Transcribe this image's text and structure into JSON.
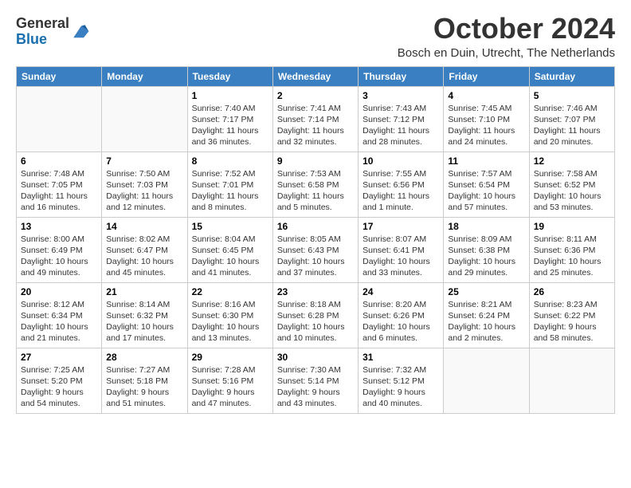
{
  "header": {
    "logo_line1": "General",
    "logo_line2": "Blue",
    "month": "October 2024",
    "location": "Bosch en Duin, Utrecht, The Netherlands"
  },
  "weekdays": [
    "Sunday",
    "Monday",
    "Tuesday",
    "Wednesday",
    "Thursday",
    "Friday",
    "Saturday"
  ],
  "weeks": [
    [
      {
        "day": "",
        "info": ""
      },
      {
        "day": "",
        "info": ""
      },
      {
        "day": "1",
        "info": "Sunrise: 7:40 AM\nSunset: 7:17 PM\nDaylight: 11 hours\nand 36 minutes."
      },
      {
        "day": "2",
        "info": "Sunrise: 7:41 AM\nSunset: 7:14 PM\nDaylight: 11 hours\nand 32 minutes."
      },
      {
        "day": "3",
        "info": "Sunrise: 7:43 AM\nSunset: 7:12 PM\nDaylight: 11 hours\nand 28 minutes."
      },
      {
        "day": "4",
        "info": "Sunrise: 7:45 AM\nSunset: 7:10 PM\nDaylight: 11 hours\nand 24 minutes."
      },
      {
        "day": "5",
        "info": "Sunrise: 7:46 AM\nSunset: 7:07 PM\nDaylight: 11 hours\nand 20 minutes."
      }
    ],
    [
      {
        "day": "6",
        "info": "Sunrise: 7:48 AM\nSunset: 7:05 PM\nDaylight: 11 hours\nand 16 minutes."
      },
      {
        "day": "7",
        "info": "Sunrise: 7:50 AM\nSunset: 7:03 PM\nDaylight: 11 hours\nand 12 minutes."
      },
      {
        "day": "8",
        "info": "Sunrise: 7:52 AM\nSunset: 7:01 PM\nDaylight: 11 hours\nand 8 minutes."
      },
      {
        "day": "9",
        "info": "Sunrise: 7:53 AM\nSunset: 6:58 PM\nDaylight: 11 hours\nand 5 minutes."
      },
      {
        "day": "10",
        "info": "Sunrise: 7:55 AM\nSunset: 6:56 PM\nDaylight: 11 hours\nand 1 minute."
      },
      {
        "day": "11",
        "info": "Sunrise: 7:57 AM\nSunset: 6:54 PM\nDaylight: 10 hours\nand 57 minutes."
      },
      {
        "day": "12",
        "info": "Sunrise: 7:58 AM\nSunset: 6:52 PM\nDaylight: 10 hours\nand 53 minutes."
      }
    ],
    [
      {
        "day": "13",
        "info": "Sunrise: 8:00 AM\nSunset: 6:49 PM\nDaylight: 10 hours\nand 49 minutes."
      },
      {
        "day": "14",
        "info": "Sunrise: 8:02 AM\nSunset: 6:47 PM\nDaylight: 10 hours\nand 45 minutes."
      },
      {
        "day": "15",
        "info": "Sunrise: 8:04 AM\nSunset: 6:45 PM\nDaylight: 10 hours\nand 41 minutes."
      },
      {
        "day": "16",
        "info": "Sunrise: 8:05 AM\nSunset: 6:43 PM\nDaylight: 10 hours\nand 37 minutes."
      },
      {
        "day": "17",
        "info": "Sunrise: 8:07 AM\nSunset: 6:41 PM\nDaylight: 10 hours\nand 33 minutes."
      },
      {
        "day": "18",
        "info": "Sunrise: 8:09 AM\nSunset: 6:38 PM\nDaylight: 10 hours\nand 29 minutes."
      },
      {
        "day": "19",
        "info": "Sunrise: 8:11 AM\nSunset: 6:36 PM\nDaylight: 10 hours\nand 25 minutes."
      }
    ],
    [
      {
        "day": "20",
        "info": "Sunrise: 8:12 AM\nSunset: 6:34 PM\nDaylight: 10 hours\nand 21 minutes."
      },
      {
        "day": "21",
        "info": "Sunrise: 8:14 AM\nSunset: 6:32 PM\nDaylight: 10 hours\nand 17 minutes."
      },
      {
        "day": "22",
        "info": "Sunrise: 8:16 AM\nSunset: 6:30 PM\nDaylight: 10 hours\nand 13 minutes."
      },
      {
        "day": "23",
        "info": "Sunrise: 8:18 AM\nSunset: 6:28 PM\nDaylight: 10 hours\nand 10 minutes."
      },
      {
        "day": "24",
        "info": "Sunrise: 8:20 AM\nSunset: 6:26 PM\nDaylight: 10 hours\nand 6 minutes."
      },
      {
        "day": "25",
        "info": "Sunrise: 8:21 AM\nSunset: 6:24 PM\nDaylight: 10 hours\nand 2 minutes."
      },
      {
        "day": "26",
        "info": "Sunrise: 8:23 AM\nSunset: 6:22 PM\nDaylight: 9 hours\nand 58 minutes."
      }
    ],
    [
      {
        "day": "27",
        "info": "Sunrise: 7:25 AM\nSunset: 5:20 PM\nDaylight: 9 hours\nand 54 minutes."
      },
      {
        "day": "28",
        "info": "Sunrise: 7:27 AM\nSunset: 5:18 PM\nDaylight: 9 hours\nand 51 minutes."
      },
      {
        "day": "29",
        "info": "Sunrise: 7:28 AM\nSunset: 5:16 PM\nDaylight: 9 hours\nand 47 minutes."
      },
      {
        "day": "30",
        "info": "Sunrise: 7:30 AM\nSunset: 5:14 PM\nDaylight: 9 hours\nand 43 minutes."
      },
      {
        "day": "31",
        "info": "Sunrise: 7:32 AM\nSunset: 5:12 PM\nDaylight: 9 hours\nand 40 minutes."
      },
      {
        "day": "",
        "info": ""
      },
      {
        "day": "",
        "info": ""
      }
    ]
  ]
}
